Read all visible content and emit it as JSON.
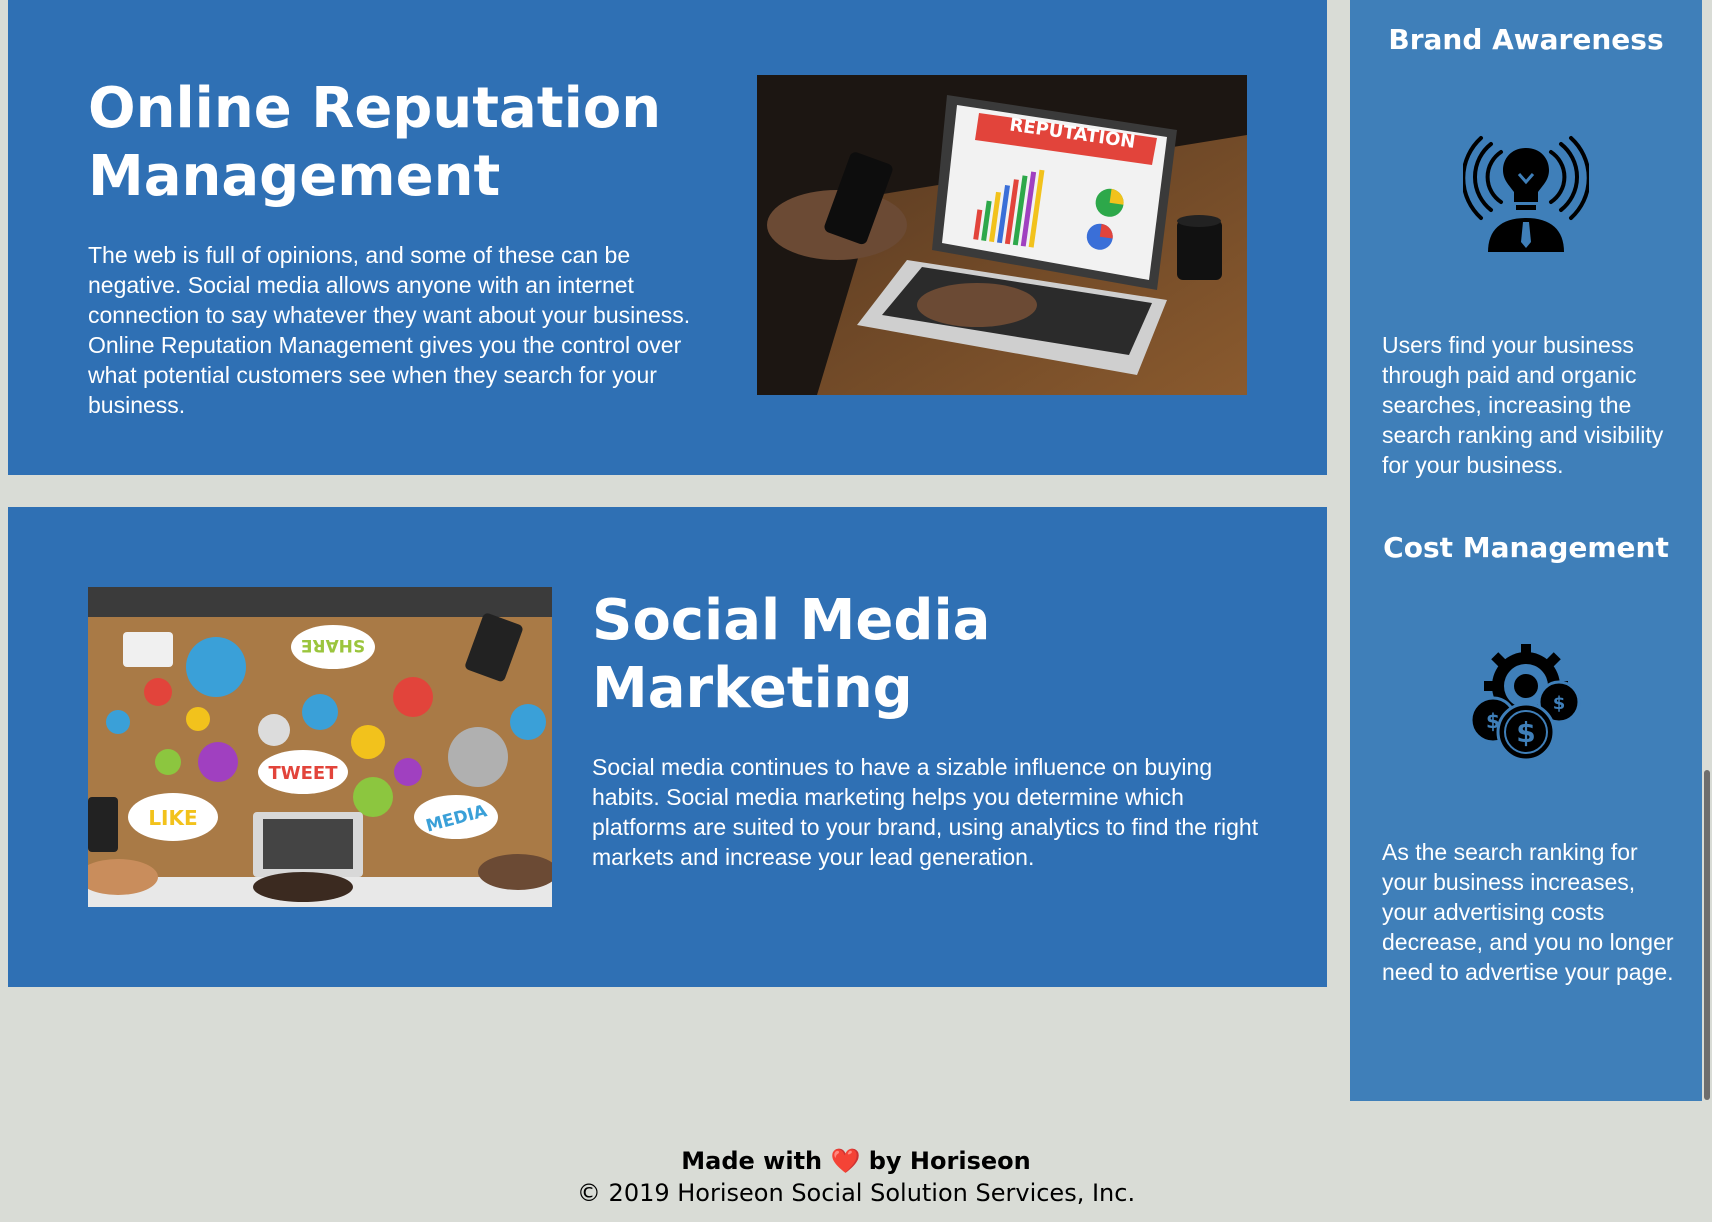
{
  "main": {
    "online_reputation": {
      "title": "Online Reputation Management",
      "body": "The web is full of opinions, and some of these can be negative. Social media allows anyone with an internet connection to say whatever they want about your business. Online Reputation Management gives you the control over what potential customers see when they search for your business.",
      "image_label": "REPUTATION"
    },
    "social_media": {
      "title": "Social Media Marketing",
      "body": "Social media continues to have a sizable influence on buying habits. Social media marketing helps you determine which platforms are suited to your brand, using analytics to find the right markets and increase your lead generation.",
      "image_bubbles": [
        "SHARE",
        "TWEET",
        "LIKE",
        "MEDIA"
      ]
    }
  },
  "sidebar": {
    "brand_awareness": {
      "title": "Brand Awareness",
      "icon": "lightbulb-broadcast-icon",
      "body": "Users find your business through paid and organic searches, increasing the search ranking and visibility for your business."
    },
    "cost_management": {
      "title": "Cost Management",
      "icon": "dollar-gear-icon",
      "body": "As the search ranking for your business increases, your advertising costs decrease, and you no longer need to advertise your page."
    }
  },
  "footer": {
    "credit_prefix": "Made with",
    "heart": "❤️",
    "credit_suffix": "by Horiseon",
    "copyright": "© 2019 Horiseon Social Solution Services, Inc."
  },
  "colors": {
    "page_background": "#d9dcd6",
    "card_background": "#2f70b4",
    "sidebar_background": "#3f7fb9",
    "text": "#ffffff",
    "footer_text": "#000000"
  }
}
